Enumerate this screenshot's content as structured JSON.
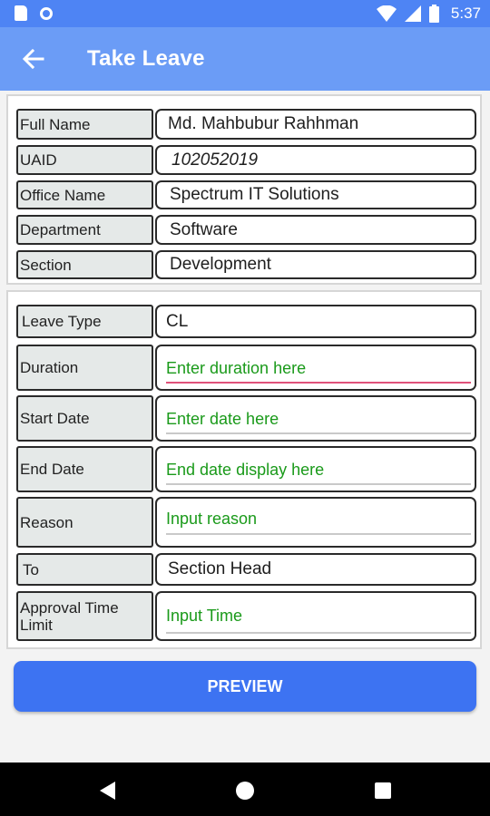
{
  "status_bar": {
    "time": "5:37"
  },
  "app_bar": {
    "title": "Take Leave"
  },
  "employee": [
    {
      "label": "Full Name",
      "value": "Md. Mahbubur Rahhman"
    },
    {
      "label": "UAID",
      "value": "102052019"
    },
    {
      "label": "Office Name",
      "value": "Spectrum IT Solutions"
    },
    {
      "label": "Department",
      "value": "Software"
    },
    {
      "label": "Section",
      "value": "Development"
    }
  ],
  "leave": {
    "leave_type": {
      "label": "Leave Type",
      "value": "CL"
    },
    "duration": {
      "label": "Duration",
      "placeholder": "Enter duration here"
    },
    "start_date": {
      "label": "Start Date",
      "placeholder": "Enter date here"
    },
    "end_date": {
      "label": "End Date",
      "placeholder": "End date display here"
    },
    "reason": {
      "label": "Reason",
      "placeholder": "Input reason"
    },
    "to": {
      "label": "To",
      "value": "Section Head"
    },
    "approval_time_limit": {
      "label": "Approval Time Limit",
      "placeholder": "Input Time"
    }
  },
  "preview_button": {
    "label": "PREVIEW"
  },
  "colors": {
    "status_bar": "#4e84f4",
    "app_bar": "#6b9cf6",
    "button": "#3d73f2",
    "placeholder": "#1a9a1a",
    "focus_underline": "#e0527a"
  }
}
